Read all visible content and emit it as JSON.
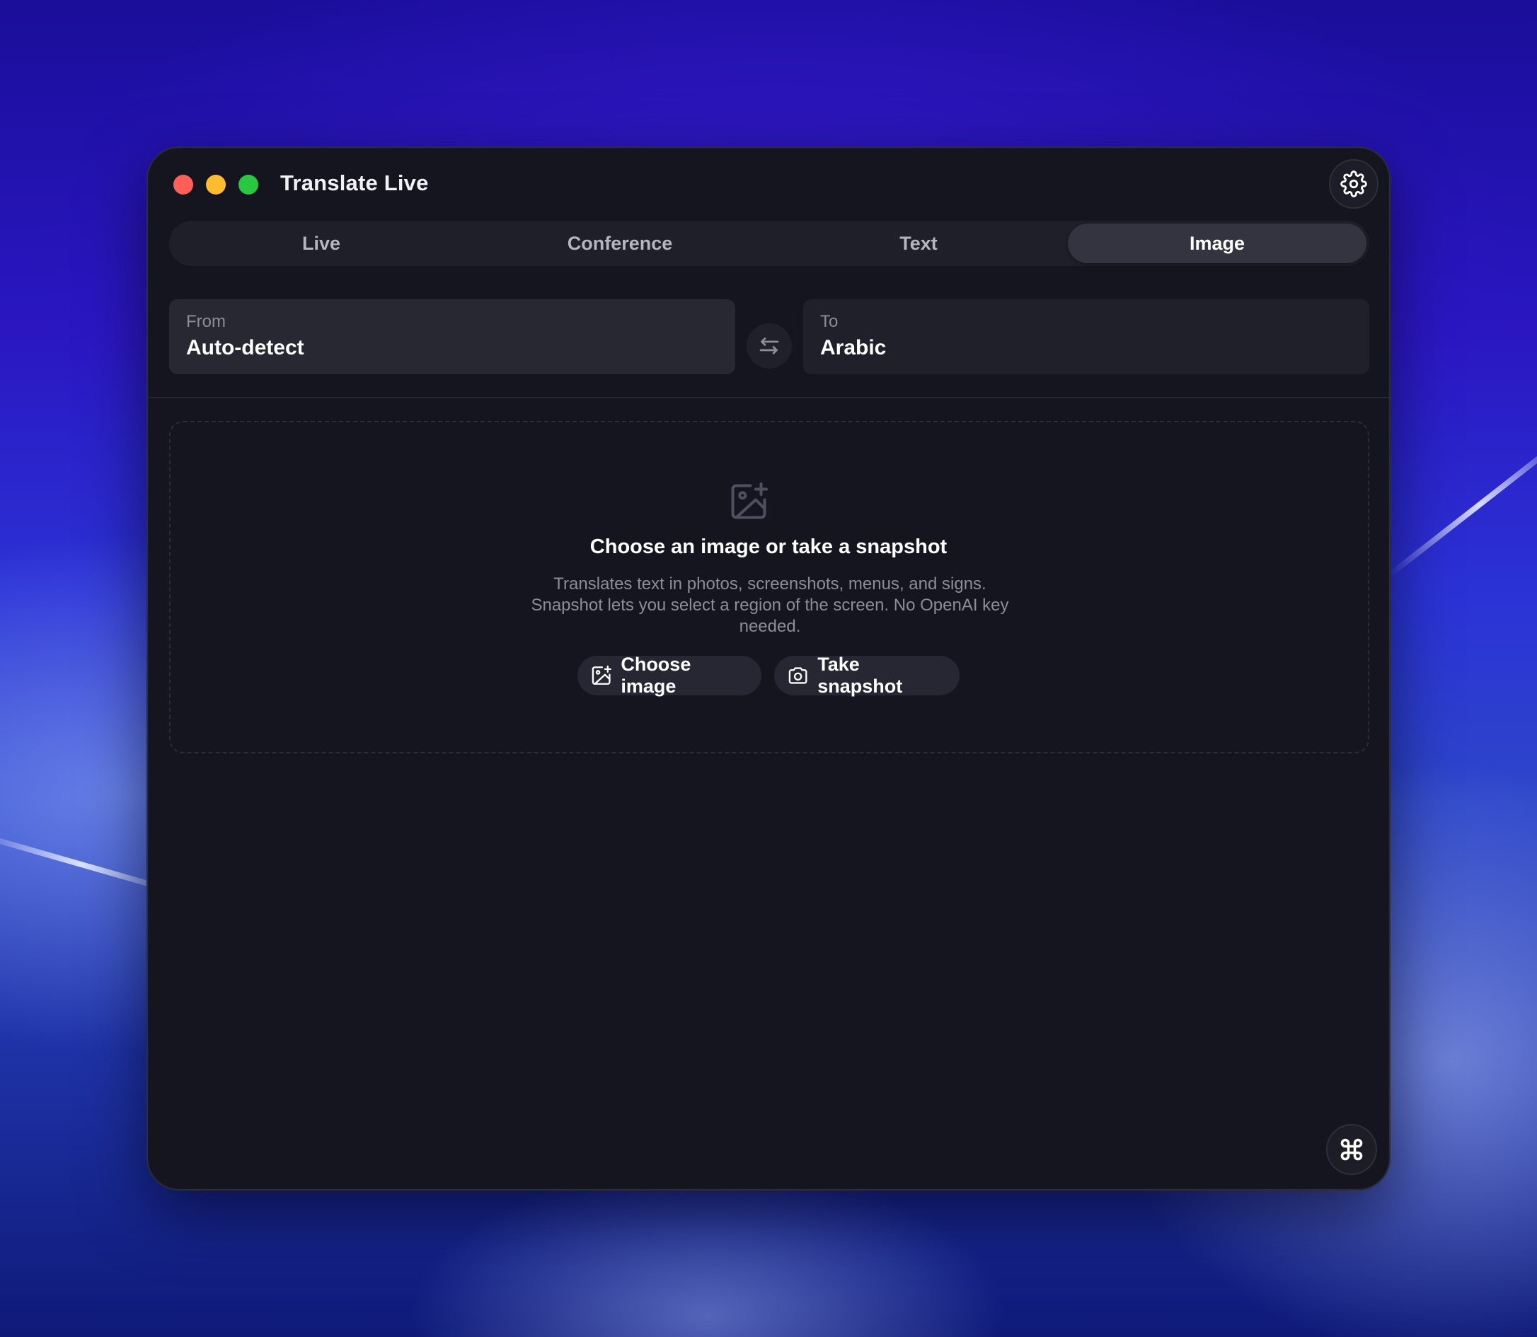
{
  "window": {
    "title": "Translate Live"
  },
  "tabs": [
    {
      "label": "Live",
      "active": false
    },
    {
      "label": "Conference",
      "active": false
    },
    {
      "label": "Text",
      "active": false
    },
    {
      "label": "Image",
      "active": true
    }
  ],
  "languages": {
    "from": {
      "caption": "From",
      "value": "Auto-detect"
    },
    "to": {
      "caption": "To",
      "value": "Arabic"
    }
  },
  "dropzone": {
    "title": "Choose an image or take a snapshot",
    "description": "Translates text in photos, screenshots, menus, and signs. Snapshot lets you select a region of the screen. No OpenAI key needed.",
    "choose_label": "Choose image",
    "snapshot_label": "Take snapshot"
  },
  "icons": {
    "settings": "gear-icon",
    "swap": "swap-arrows-icon",
    "image_add": "image-add-icon",
    "camera": "camera-icon",
    "corner": "command-key-icon"
  },
  "colors": {
    "window_bg": "#14151e",
    "close": "#ff5f57",
    "minimize": "#febc2e",
    "maximize": "#28c840",
    "active_tab": "#33343f"
  }
}
